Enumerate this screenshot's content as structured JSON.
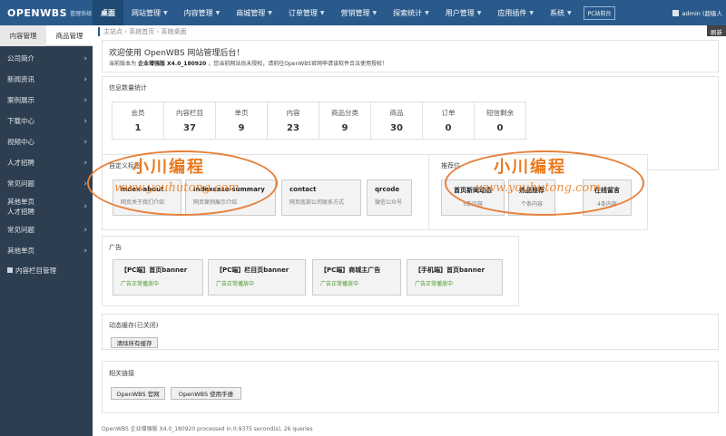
{
  "header": {
    "brand": "OPENWBS",
    "brand_sub": "管理系统",
    "nav": [
      {
        "label": "桌面",
        "caret": false,
        "active": true
      },
      {
        "label": "网站管理",
        "caret": true
      },
      {
        "label": "内容管理",
        "caret": true
      },
      {
        "label": "商城管理",
        "caret": true
      },
      {
        "label": "订单管理",
        "caret": true
      },
      {
        "label": "营销管理",
        "caret": true
      },
      {
        "label": "探索统计",
        "caret": true
      },
      {
        "label": "用户管理",
        "caret": true
      },
      {
        "label": "应用插件",
        "caret": true
      },
      {
        "label": "系统",
        "caret": true
      }
    ],
    "badge": "PC站前台",
    "user": "admin (超级人"
  },
  "sidebar": {
    "tabs": [
      "内容管理",
      "商品管理"
    ],
    "items": [
      "公司简介",
      "新闻资讯",
      "案例展示",
      "下载中心",
      "视频中心",
      "人才招聘",
      "常见问题"
    ],
    "item_multi": [
      "其他单页",
      "人才招聘"
    ],
    "items2": [
      "常见问题",
      "其他单页"
    ],
    "last": "内容栏目管理"
  },
  "main": {
    "close_tab": "刷新",
    "breadcrumb": [
      "主站点",
      "系统首页",
      "系统桌面"
    ],
    "welcome_title": "欢迎使用 OpenWBS 网站管理后台！",
    "welcome_prefix": "当前版本为",
    "welcome_version": "企业增强版 X4.0_180920",
    "welcome_suffix": "，您当前网站尚未授权，请前往OpenWBS官网申请该软件合法使用授权！",
    "stats_title": "信息数量统计",
    "stats": [
      {
        "label": "会员",
        "value": "1"
      },
      {
        "label": "内容栏目",
        "value": "37"
      },
      {
        "label": "单页",
        "value": "9"
      },
      {
        "label": "内容",
        "value": "23"
      },
      {
        "label": "商品分类",
        "value": "9"
      },
      {
        "label": "商品",
        "value": "30"
      },
      {
        "label": "订单",
        "value": "0"
      },
      {
        "label": "短信剩余",
        "value": "0"
      }
    ],
    "custom_title": "自定义标签",
    "custom_cards": [
      {
        "title": "index-about",
        "desc": "网页关于我们介绍"
      },
      {
        "title": "indexcase-summary",
        "desc": "网页案例展示介绍"
      },
      {
        "title": "contact",
        "desc": "网页底部公司联系方式"
      },
      {
        "title": "qrcode",
        "desc": "微信公众号"
      }
    ],
    "rec_title": "推荐位",
    "rec_cards": [
      {
        "title": "首页新闻动态",
        "desc": "5条内容"
      },
      {
        "title": "热品推荐",
        "desc": "个条内容"
      },
      {
        "title": "在线留言",
        "desc": "4条内容"
      }
    ],
    "ad_title": "广告",
    "ad_cards": [
      {
        "title": "【PC端】首页banner",
        "status": "广告正常播放中"
      },
      {
        "title": "【PC端】栏目页banner",
        "status": "广告正常播放中"
      },
      {
        "title": "【PC端】商城主广告",
        "status": "广告正常播放中"
      },
      {
        "title": "【手机端】首页banner",
        "status": "广告正常播放中"
      }
    ],
    "cache_title": "动态缓存(已关闭)",
    "cache_button": "清除所有缓存",
    "links_title": "相关链接",
    "links": [
      "OpenWBS 官网",
      "OpenWBS 使用手册"
    ],
    "footer": "OpenWBS 企业增强版 X4.0_180920 processed in 0.9375 second(s), 26 queries"
  },
  "watermark": {
    "text": "小川编程",
    "url": "www.youhutong.com"
  }
}
